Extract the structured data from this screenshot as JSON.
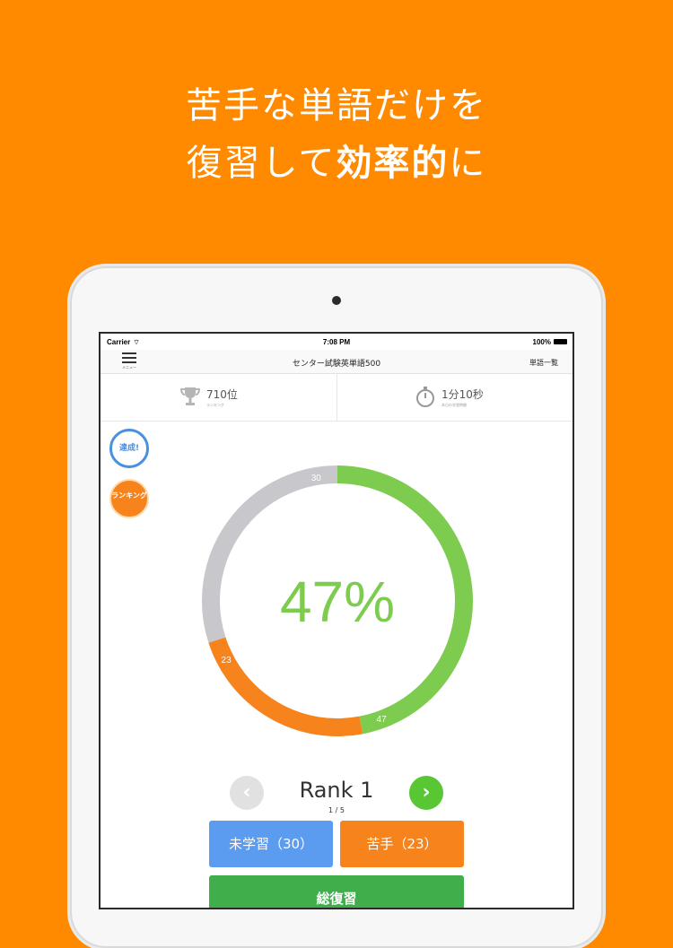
{
  "headline": {
    "line1": "苦手な単語だけを",
    "line2_prefix": "復習して",
    "line2_bold": "効率的",
    "line2_suffix": "に"
  },
  "status_bar": {
    "carrier": "Carrier",
    "time": "7:08 PM",
    "battery": "100%"
  },
  "nav": {
    "menu_caption": "メニュー",
    "title": "センター試験英単語500",
    "right_button": "単語一覧"
  },
  "stats": {
    "rank_value": "710位",
    "rank_caption": "ランキング",
    "time_value": "1分10秒",
    "time_caption": "本日の学習時間"
  },
  "badges": {
    "achieved": "達成!",
    "ranking": "ランキング"
  },
  "chart_data": {
    "type": "pie",
    "center_label": "47%",
    "slices": [
      {
        "label": "47",
        "value": 47,
        "color": "#7DCB4F"
      },
      {
        "label": "23",
        "value": 23,
        "color": "#F7831C"
      },
      {
        "label": "30",
        "value": 30,
        "color": "#C8C8CC"
      }
    ]
  },
  "pager": {
    "rank_label": "Rank 1",
    "page_indicator": "1 / 5"
  },
  "buttons": {
    "unlearned": "未学習（30）",
    "weak": "苦手（23）",
    "review": "総復習"
  },
  "colors": {
    "background": "#FF8A00",
    "green": "#7DCB4F",
    "orange": "#F7831C",
    "gray": "#C8C8CC",
    "blue": "#5B9BF0"
  }
}
